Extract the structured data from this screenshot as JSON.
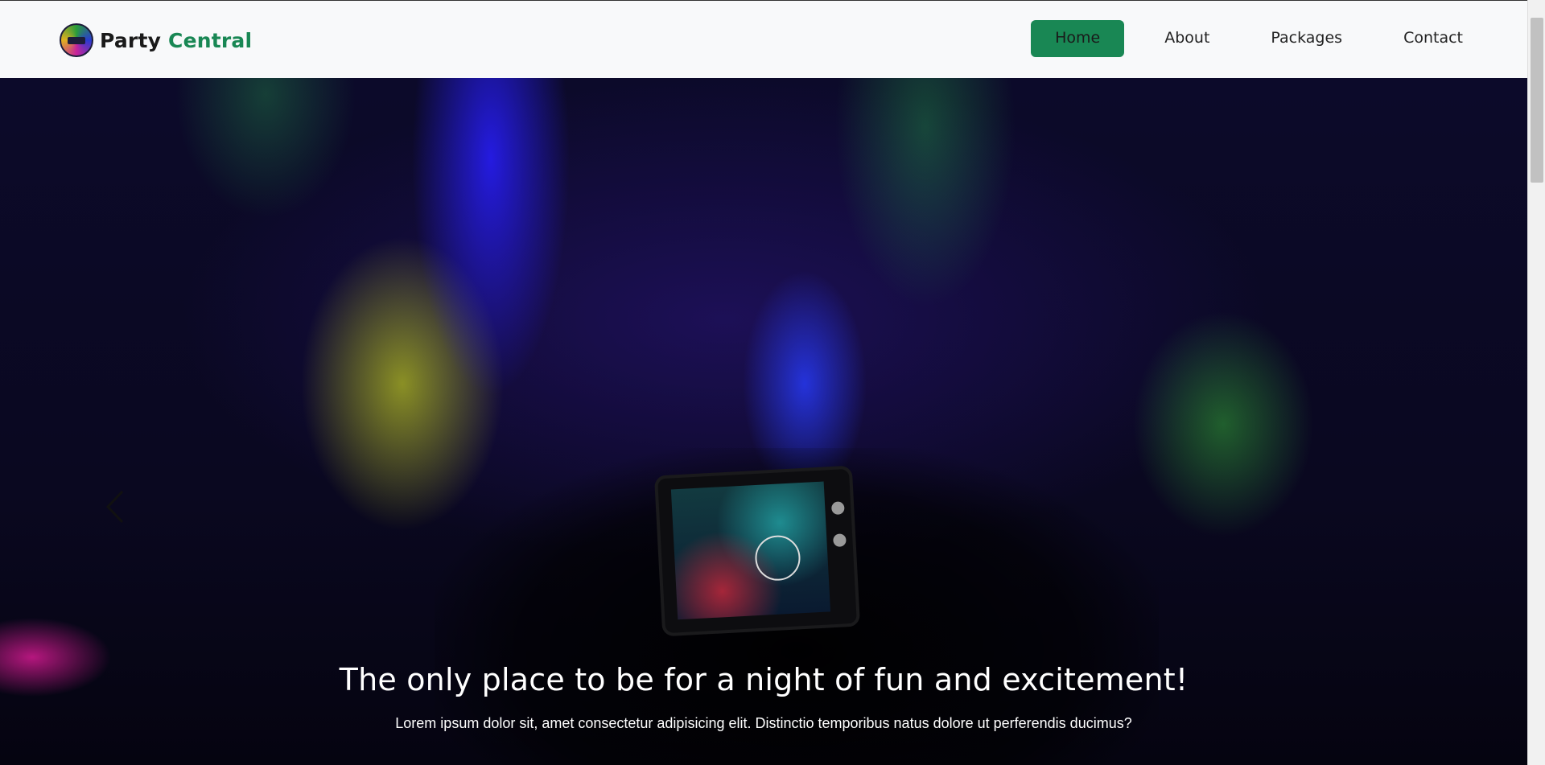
{
  "navbar": {
    "brand_part1": "Party",
    "brand_part2": "Central",
    "links": [
      {
        "label": "Home",
        "active": true
      },
      {
        "label": "About",
        "active": false
      },
      {
        "label": "Packages",
        "active": false
      },
      {
        "label": "Contact",
        "active": false
      }
    ]
  },
  "hero": {
    "heading": "The only place to be for a night of fun and excitement!",
    "text": "Lorem ipsum dolor sit, amet consectetur adipisicing elit. Distinctio temporibus natus dolore ut perferendis ducimus?",
    "prev_icon": "chevron-left-icon"
  },
  "colors": {
    "accent": "#198754",
    "navbar_bg": "#f8f9fa"
  }
}
